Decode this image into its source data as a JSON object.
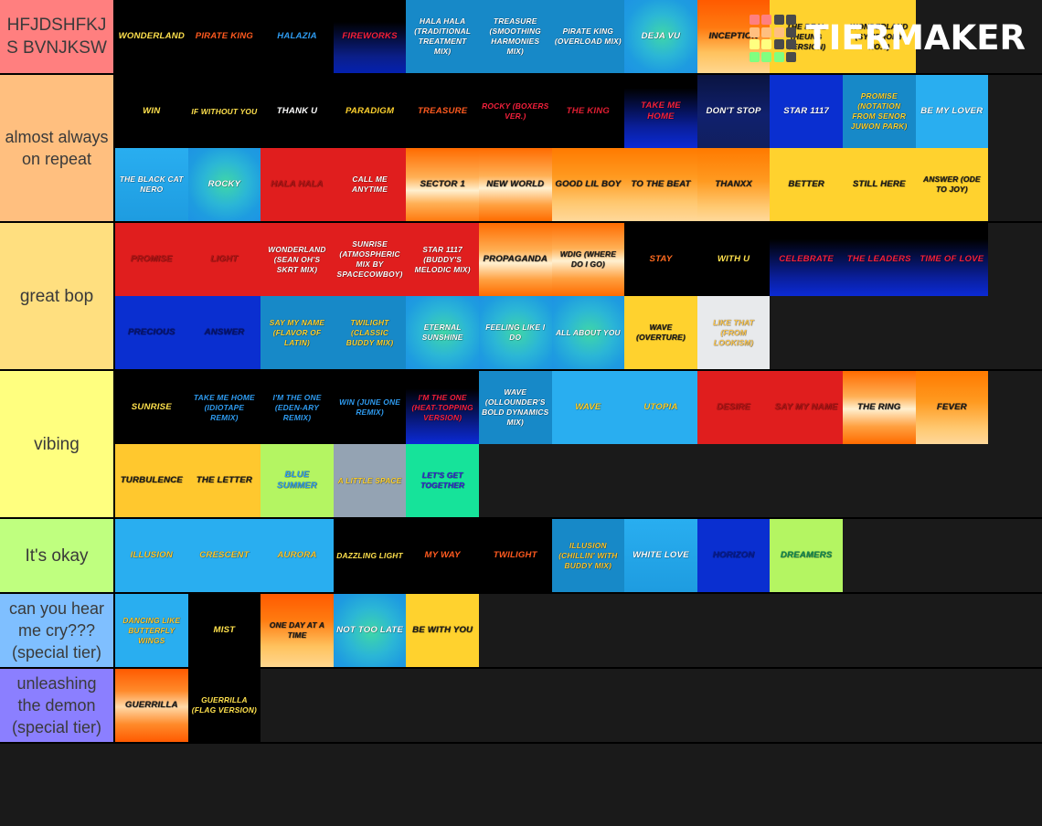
{
  "brand": {
    "name": "TIERMAKER",
    "logo_colors": [
      "#ff8080",
      "#ff8080",
      "#4a4a4a",
      "#4a4a4a",
      "#ffbf80",
      "#ffbf80",
      "#ffbf80",
      "#4a4a4a",
      "#ffff80",
      "#ffff80",
      "#4a4a4a",
      "#4a4a4a",
      "#80ff80",
      "#80ff80",
      "#80ff80",
      "#4a4a4a"
    ]
  },
  "palette": {
    "tier1": "#ff7f7f",
    "tier2": "#ffbf7f",
    "tier3": "#ffdf7f",
    "tier4": "#ffff7f",
    "tier5": "#bfff7f",
    "tier6": "#7fbfff",
    "tier7": "#8b7fff",
    "background": "#1a1a1a"
  },
  "tiers": [
    {
      "label": "HFJDSHFKJS BVNJKSW",
      "color": "#ff7f7f",
      "items": [
        {
          "title": "WONDERLAND",
          "bg": "linear-gradient(180deg,#000 0%,#000 100%)",
          "fg": "#ffe14d"
        },
        {
          "title": "PIRATE KING",
          "bg": "linear-gradient(180deg,#000 0%,#000 100%)",
          "fg": "#ff5a1f"
        },
        {
          "title": "HALAZIA",
          "bg": "linear-gradient(180deg,#000 0%,#000 100%)",
          "fg": "#2e9bf0"
        },
        {
          "title": "FIREWORKS",
          "bg": "linear-gradient(180deg,#000 30%,#0b1f8a 78%,#0420b0 100%)",
          "fg": "#f4203c"
        },
        {
          "title": "HALA HALA (TRADITIONAL TREATMENT MIX)",
          "bg": "linear-gradient(180deg,#1789c8 0%,#1789c8 100%)",
          "fg": "#ffffff"
        },
        {
          "title": "TREASURE (SMOOTHING HARMONIES MIX)",
          "bg": "linear-gradient(180deg,#1789c8 0%,#1789c8 100%)",
          "fg": "#ffffff"
        },
        {
          "title": "PIRATE KING (OVERLOAD MIX)",
          "bg": "linear-gradient(180deg,#1789c8 0%,#1789c8 100%)",
          "fg": "#ffffff"
        },
        {
          "title": "DEJA VU",
          "bg": "radial-gradient(circle at 52% 48%, #3fd6a8 0%, #2bb6d6 40%, #1e9ce0 70%, #1d93e4 100%)",
          "fg": "#ffffff"
        },
        {
          "title": "INCEPTION",
          "bg": "linear-gradient(180deg,#ff5a00 0%,#ff7a10 38%,#ffc25e 72%,#ffd78f 100%)",
          "fg": "#1a1a1a"
        },
        {
          "title": "THE REAL (HEUNG VERSION)",
          "bg": "linear-gradient(180deg,#ffd22e 0%,#ffd22e 100%)",
          "fg": "#1a1a1a"
        },
        {
          "title": "WONDERLAND (SYMPHONY NO.9)",
          "bg": "linear-gradient(180deg,#ffd22e 0%,#ffd22e 100%)",
          "fg": "#1a1a1a"
        }
      ]
    },
    {
      "label": "almost always on repeat",
      "color": "#ffbf7f",
      "items": [
        {
          "title": "WIN",
          "bg": "linear-gradient(180deg,#000 0%,#000 100%)",
          "fg": "#ffe14d"
        },
        {
          "title": "IF WITHOUT YOU",
          "bg": "linear-gradient(180deg,#000 0%,#000 100%)",
          "fg": "#ffe14d"
        },
        {
          "title": "THANK U",
          "bg": "linear-gradient(180deg,#000 0%,#000 100%)",
          "fg": "#ffffff"
        },
        {
          "title": "PARADIGM",
          "bg": "linear-gradient(180deg,#000 0%,#000 100%)",
          "fg": "#ffd22e"
        },
        {
          "title": "TREASURE",
          "bg": "linear-gradient(180deg,#000 0%,#000 100%)",
          "fg": "#ff5a1f"
        },
        {
          "title": "ROCKY (BOXERS VER.)",
          "bg": "linear-gradient(180deg,#000 0%,#000 100%)",
          "fg": "#f4203c"
        },
        {
          "title": "THE KING",
          "bg": "linear-gradient(180deg,#000 0%,#000 100%)",
          "fg": "#e01e32"
        },
        {
          "title": "TAKE ME HOME",
          "bg": "linear-gradient(180deg,#000 18%,#0a1f9c 72%,#0b2ad6 100%)",
          "fg": "#f4203c"
        },
        {
          "title": "DON'T STOP",
          "bg": "linear-gradient(180deg,#0a1440 0%,#10206e 55%,#111f5e 100%)",
          "fg": "#ffffff"
        },
        {
          "title": "STAR 1117",
          "bg": "linear-gradient(180deg,#0a2fd0 0%,#0a2fd0 100%)",
          "fg": "#ffffff"
        },
        {
          "title": "PROMISE (NOTATION FROM SENOR JUWON PARK)",
          "bg": "linear-gradient(180deg,#1789c8 0%,#1789c8 100%)",
          "fg": "#ffd22e"
        },
        {
          "title": "BE MY LOVER",
          "bg": "linear-gradient(180deg,#29aef0 0%,#29aef0 100%)",
          "fg": "#ffffff"
        },
        {
          "title": "THE BLACK CAT NERO",
          "bg": "linear-gradient(180deg,#29aef0 0%,#1e9ce0 100%)",
          "fg": "#ffffff"
        },
        {
          "title": "ROCKY",
          "bg": "radial-gradient(circle at 52% 48%, #3fd6a8 0%, #2bb6d6 42%, #1e9ce0 72%, #1d93e4 100%)",
          "fg": "#ffffff"
        },
        {
          "title": "HALA HALA",
          "bg": "linear-gradient(180deg,#e01e1e 0%,#e01e1e 100%)",
          "fg": "#b01414"
        },
        {
          "title": "CALL ME ANYTIME",
          "bg": "linear-gradient(180deg,#e01e1e 0%,#e01e1e 100%)",
          "fg": "#ffffff"
        },
        {
          "title": "SECTOR 1",
          "bg": "linear-gradient(180deg,#ff6b00 0%,#ffb055 40%,#fff0d0 58%,#ffb055 76%,#ff7a10 100%)",
          "fg": "#1a1a1a"
        },
        {
          "title": "NEW WORLD",
          "bg": "linear-gradient(180deg,#ff6b00 0%,#ffb055 38%,#fff0d0 55%,#ffa040 78%,#ff6b00 100%)",
          "fg": "#1a1a1a"
        },
        {
          "title": "GOOD LIL BOY",
          "bg": "linear-gradient(180deg,#ff7a00 0%,#ff9a20 40%,#ffc870 75%,#ffd89a 100%)",
          "fg": "#1a1a1a"
        },
        {
          "title": "TO THE BEAT",
          "bg": "linear-gradient(180deg,#ff7a00 0%,#ff9a20 40%,#ffc870 75%,#ffd89a 100%)",
          "fg": "#1a1a1a"
        },
        {
          "title": "THANXX",
          "bg": "linear-gradient(180deg,#ff7a00 0%,#ff9a20 45%,#ffc870 80%,#ffd89a 100%)",
          "fg": "#1a1a1a"
        },
        {
          "title": "BETTER",
          "bg": "linear-gradient(180deg,#ffd22e 0%,#ffd22e 100%)",
          "fg": "#1a1a1a"
        },
        {
          "title": "STILL HERE",
          "bg": "linear-gradient(180deg,#ffd22e 0%,#ffd22e 100%)",
          "fg": "#1a1a1a"
        },
        {
          "title": "ANSWER (ODE TO JOY)",
          "bg": "linear-gradient(180deg,#ffd22e 0%,#ffd22e 100%)",
          "fg": "#1a1a1a"
        }
      ]
    },
    {
      "label": "great bop",
      "color": "#ffdf7f",
      "items": [
        {
          "title": "PROMISE",
          "bg": "linear-gradient(180deg,#e01e1e 0%,#e01e1e 100%)",
          "fg": "#b01414"
        },
        {
          "title": "LIGHT",
          "bg": "linear-gradient(180deg,#e01e1e 0%,#e01e1e 100%)",
          "fg": "#b01414"
        },
        {
          "title": "WONDERLAND (SEAN OH'S SKRT MIX)",
          "bg": "linear-gradient(180deg,#e01e1e 0%,#e01e1e 100%)",
          "fg": "#ffffff"
        },
        {
          "title": "SUNRISE (ATMOSPHERIC MIX BY SPACECOWBOY)",
          "bg": "linear-gradient(180deg,#e01e1e 0%,#e01e1e 100%)",
          "fg": "#ffffff"
        },
        {
          "title": "STAR 1117 (BUDDY'S MELODIC MIX)",
          "bg": "linear-gradient(180deg,#e01e1e 0%,#e01e1e 100%)",
          "fg": "#ffffff"
        },
        {
          "title": "PROPAGANDA",
          "bg": "linear-gradient(180deg,#ff6b00 0%,#ffb055 38%,#fff0d0 55%,#ffa040 78%,#ff6b00 100%)",
          "fg": "#1a1a1a"
        },
        {
          "title": "WDIG (WHERE DO I GO)",
          "bg": "linear-gradient(180deg,#ff6b00 0%,#ffb055 35%,#fff0d0 52%,#ffa040 76%,#ff6b00 100%)",
          "fg": "#1a1a1a"
        },
        {
          "title": "STAY",
          "bg": "linear-gradient(180deg,#000 0%,#000 100%)",
          "fg": "#ff6b1f"
        },
        {
          "title": "WITH U",
          "bg": "linear-gradient(180deg,#000 0%,#000 100%)",
          "fg": "#ffe14d"
        },
        {
          "title": "CELEBRATE",
          "bg": "linear-gradient(180deg,#000 22%,#0a1f9c 75%,#0b2ad6 100%)",
          "fg": "#f4203c"
        },
        {
          "title": "THE LEADERS",
          "bg": "linear-gradient(180deg,#000 22%,#0a1f9c 75%,#0b2ad6 100%)",
          "fg": "#f4203c"
        },
        {
          "title": "TIME OF LOVE",
          "bg": "linear-gradient(180deg,#000 22%,#0a1f9c 75%,#0b2ad6 100%)",
          "fg": "#f4203c"
        },
        {
          "title": "PRECIOUS",
          "bg": "linear-gradient(180deg,#0a2fd0 0%,#0a2fd0 100%)",
          "fg": "#07126e"
        },
        {
          "title": "ANSWER",
          "bg": "linear-gradient(180deg,#0a2fd0 0%,#0a2fd0 100%)",
          "fg": "#07126e"
        },
        {
          "title": "SAY MY NAME (FLAVOR OF LATIN)",
          "bg": "linear-gradient(180deg,#1789c8 0%,#1789c8 100%)",
          "fg": "#ffd22e"
        },
        {
          "title": "TWILIGHT (CLASSIC BUDDY MIX)",
          "bg": "linear-gradient(180deg,#1789c8 0%,#1789c8 100%)",
          "fg": "#ffd22e"
        },
        {
          "title": "ETERNAL SUNSHINE",
          "bg": "radial-gradient(circle at 52% 50%, #3fd6a8 0%, #2bb6d6 45%, #1e9ce0 78%, #1d93e4 100%)",
          "fg": "#ffffff"
        },
        {
          "title": "FEELING LIKE I DO",
          "bg": "radial-gradient(circle at 52% 50%, #3fd6a8 0%, #2bb6d6 45%, #1e9ce0 78%, #1d93e4 100%)",
          "fg": "#ffffff"
        },
        {
          "title": "ALL ABOUT YOU",
          "bg": "radial-gradient(circle at 52% 50%, #3fd6a8 0%, #2bb6d6 45%, #1e9ce0 78%, #1d93e4 100%)",
          "fg": "#ffffff"
        },
        {
          "title": "WAVE (OVERTURE)",
          "bg": "linear-gradient(180deg,#ffd22e 0%,#ffd22e 100%)",
          "fg": "#1a1a1a"
        },
        {
          "title": "LIKE THAT (FROM LOOKISM)",
          "bg": "linear-gradient(180deg,#e8eaec 0%,#e8eaec 100%)",
          "fg": "#ffc84d"
        }
      ]
    },
    {
      "label": "vibing",
      "color": "#ffff7f",
      "items": [
        {
          "title": "SUNRISE",
          "bg": "linear-gradient(180deg,#000 0%,#000 100%)",
          "fg": "#ffe14d"
        },
        {
          "title": "TAKE ME HOME (IDIOTAPE REMIX)",
          "bg": "linear-gradient(180deg,#000 0%,#000 100%)",
          "fg": "#2e9bf0"
        },
        {
          "title": "I'M THE ONE (EDEN-ARY REMIX)",
          "bg": "linear-gradient(180deg,#000 0%,#000 100%)",
          "fg": "#2e9bf0"
        },
        {
          "title": "WIN (JUNE ONE REMIX)",
          "bg": "linear-gradient(180deg,#000 0%,#000 100%)",
          "fg": "#2e9bf0"
        },
        {
          "title": "I'M THE ONE (HEAT-TOPPING VERSION)",
          "bg": "linear-gradient(180deg,#000 24%,#0a1f9c 78%,#0b2ad6 100%)",
          "fg": "#f4203c"
        },
        {
          "title": "WAVE (OLLOUNDER'S BOLD DYNAMICS MIX)",
          "bg": "linear-gradient(180deg,#1789c8 0%,#1789c8 100%)",
          "fg": "#ffffff"
        },
        {
          "title": "WAVE",
          "bg": "linear-gradient(180deg,#29aef0 0%,#29aef0 100%)",
          "fg": "#ffd22e"
        },
        {
          "title": "UTOPIA",
          "bg": "linear-gradient(180deg,#29aef0 0%,#29aef0 100%)",
          "fg": "#ffd22e"
        },
        {
          "title": "DESIRE",
          "bg": "linear-gradient(180deg,#e01e1e 0%,#e01e1e 100%)",
          "fg": "#b01414"
        },
        {
          "title": "SAY MY NAME",
          "bg": "linear-gradient(180deg,#e01e1e 0%,#e01e1e 100%)",
          "fg": "#b01414"
        },
        {
          "title": "THE RING",
          "bg": "linear-gradient(180deg,#ff6b00 0%,#ffb055 35%,#fff0d0 52%,#ffa040 76%,#ff6b00 100%)",
          "fg": "#1a1a1a"
        },
        {
          "title": "FEVER",
          "bg": "linear-gradient(180deg,#ff7a00 0%,#ff9a20 42%,#ffc870 78%,#ffd89a 100%)",
          "fg": "#1a1a1a"
        },
        {
          "title": "TURBULENCE",
          "bg": "linear-gradient(180deg,#ffc82e 0%,#ffc82e 100%)",
          "fg": "#1a1a1a"
        },
        {
          "title": "THE LETTER",
          "bg": "linear-gradient(180deg,#ffc82e 0%,#ffc82e 100%)",
          "fg": "#1a1a1a"
        },
        {
          "title": "BLUE SUMMER",
          "bg": "linear-gradient(180deg,#b4f562 0%,#b4f562 100%)",
          "fg": "#2e9bf0"
        },
        {
          "title": "A LITTLE SPACE",
          "bg": "linear-gradient(180deg,#94a3b3 0%,#94a3b3 100%)",
          "fg": "#ffd22e"
        },
        {
          "title": "LET'S GET TOGETHER",
          "bg": "linear-gradient(180deg,#16e39a 0%,#16e39a 100%)",
          "fg": "#3a1fd6"
        }
      ]
    },
    {
      "label": "It's okay",
      "color": "#bfff7f",
      "items": [
        {
          "title": "ILLUSION",
          "bg": "linear-gradient(180deg,#29aef0 0%,#29aef0 100%)",
          "fg": "#ffc82e"
        },
        {
          "title": "CRESCENT",
          "bg": "linear-gradient(180deg,#29aef0 0%,#29aef0 100%)",
          "fg": "#ffc82e"
        },
        {
          "title": "AURORA",
          "bg": "linear-gradient(180deg,#29aef0 0%,#29aef0 100%)",
          "fg": "#ffc82e"
        },
        {
          "title": "DAZZLING LIGHT",
          "bg": "linear-gradient(180deg,#000 0%,#000 100%)",
          "fg": "#ffe14d"
        },
        {
          "title": "MY WAY",
          "bg": "linear-gradient(180deg,#000 0%,#000 100%)",
          "fg": "#ff5a1f"
        },
        {
          "title": "TWILIGHT",
          "bg": "linear-gradient(180deg,#000 0%,#000 100%)",
          "fg": "#ff5a1f"
        },
        {
          "title": "ILLUSION (CHILLIN' WITH BUDDY MIX)",
          "bg": "linear-gradient(180deg,#1789c8 0%,#1789c8 100%)",
          "fg": "#ffc82e"
        },
        {
          "title": "WHITE LOVE",
          "bg": "linear-gradient(180deg,#29aef0 0%,#1e9ce0 100%)",
          "fg": "#ffffff"
        },
        {
          "title": "HORIZON",
          "bg": "linear-gradient(180deg,#0a2fd0 0%,#0a2fd0 100%)",
          "fg": "#071a8e"
        },
        {
          "title": "DREAMERS",
          "bg": "linear-gradient(180deg,#b4f562 0%,#b4f562 100%)",
          "fg": "#0f8a52"
        }
      ]
    },
    {
      "label": "can you hear me cry??? (special tier)",
      "color": "#7fbfff",
      "items": [
        {
          "title": "DANCING LIKE BUTTERFLY WINGS",
          "bg": "linear-gradient(180deg,#29aef0 0%,#29aef0 100%)",
          "fg": "#ffc82e"
        },
        {
          "title": "MIST",
          "bg": "linear-gradient(180deg,#000 0%,#000 100%)",
          "fg": "#ffe14d"
        },
        {
          "title": "ONE DAY AT A TIME",
          "bg": "linear-gradient(180deg,#ff5a00 0%,#ff7a10 35%,#ffc25e 72%,#ffd78f 100%)",
          "fg": "#1a1a1a"
        },
        {
          "title": "NOT TOO LATE",
          "bg": "radial-gradient(circle at 52% 52%, #3fd6a8 0%, #2bb6d6 45%, #1e9ce0 78%, #1d93e4 100%)",
          "fg": "#ffffff"
        },
        {
          "title": "BE WITH YOU",
          "bg": "linear-gradient(180deg,#ffd22e 0%,#ffd22e 100%)",
          "fg": "#1a1a1a"
        }
      ]
    },
    {
      "label": "unleashing the demon (special tier)",
      "color": "#8b7fff",
      "items": [
        {
          "title": "GUERRILLA",
          "bg": "linear-gradient(180deg,#ff5a00 0%,#ff8a2a 30%,#ffd9a8 52%,#ff8a2a 76%,#ff5a00 100%)",
          "fg": "#1a1a1a"
        },
        {
          "title": "GUERRILLA (FLAG VERSION)",
          "bg": "linear-gradient(180deg,#000 0%,#000 100%)",
          "fg": "#ffe14d"
        }
      ]
    }
  ]
}
